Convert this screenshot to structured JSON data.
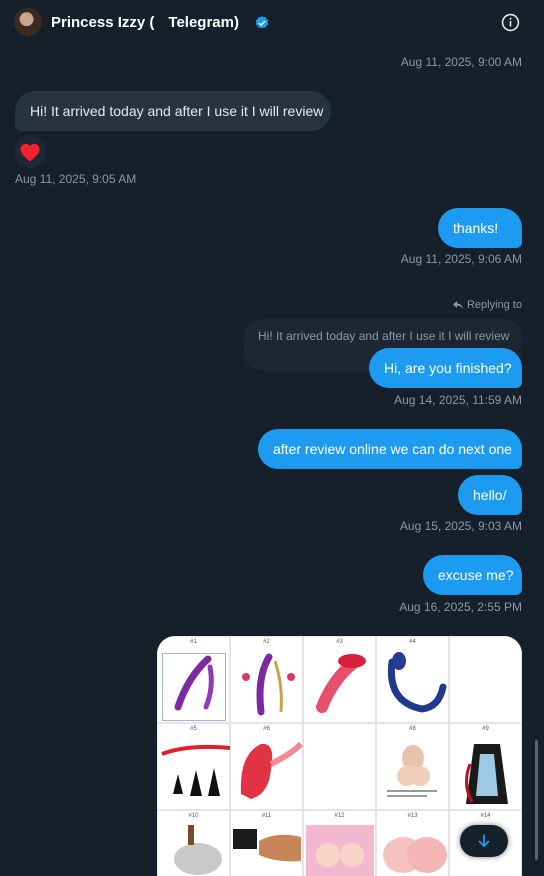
{
  "header": {
    "contact_name_start": "Princess Izzy (",
    "contact_name_end": "Telegram)",
    "verified_icon": "verified-badge-icon",
    "info_icon": "info-icon"
  },
  "messages": [
    {
      "type": "timestamp",
      "text": "Aug 11, 2025, 9:00 AM"
    },
    {
      "type": "incoming",
      "text": "Hi! It arrived today and after I use it I will review",
      "reaction": "heart"
    },
    {
      "type": "timestamp",
      "text": "Aug 11, 2025, 9:05 AM"
    },
    {
      "type": "outgoing",
      "text": "thanks!"
    },
    {
      "type": "timestamp",
      "text": "Aug 11, 2025, 9:06 AM"
    },
    {
      "type": "reply_label",
      "text": "Replying to"
    },
    {
      "type": "quoted",
      "text": "Hi! It arrived today and after I use it I will review"
    },
    {
      "type": "outgoing",
      "text": "Hi, are you finished?"
    },
    {
      "type": "timestamp",
      "text": "Aug 14, 2025, 11:59 AM"
    },
    {
      "type": "outgoing",
      "text": "after review online we can do next one"
    },
    {
      "type": "outgoing",
      "text": "hello/"
    },
    {
      "type": "timestamp",
      "text": "Aug 15, 2025, 9:03 AM"
    },
    {
      "type": "outgoing",
      "text": "excuse me?"
    },
    {
      "type": "timestamp",
      "text": "Aug 16, 2025, 2:55 PM"
    }
  ],
  "image_grid": {
    "labels": [
      "#1",
      "#2",
      "#3",
      "#4",
      "#5",
      "#6",
      "#8",
      "#9",
      "#10",
      "#11",
      "#12",
      "#13",
      "#14"
    ]
  },
  "colors": {
    "background": "#15202b",
    "incoming_bubble": "#273340",
    "outgoing_bubble": "#1d9bf0",
    "muted_text": "#8b98a5"
  }
}
